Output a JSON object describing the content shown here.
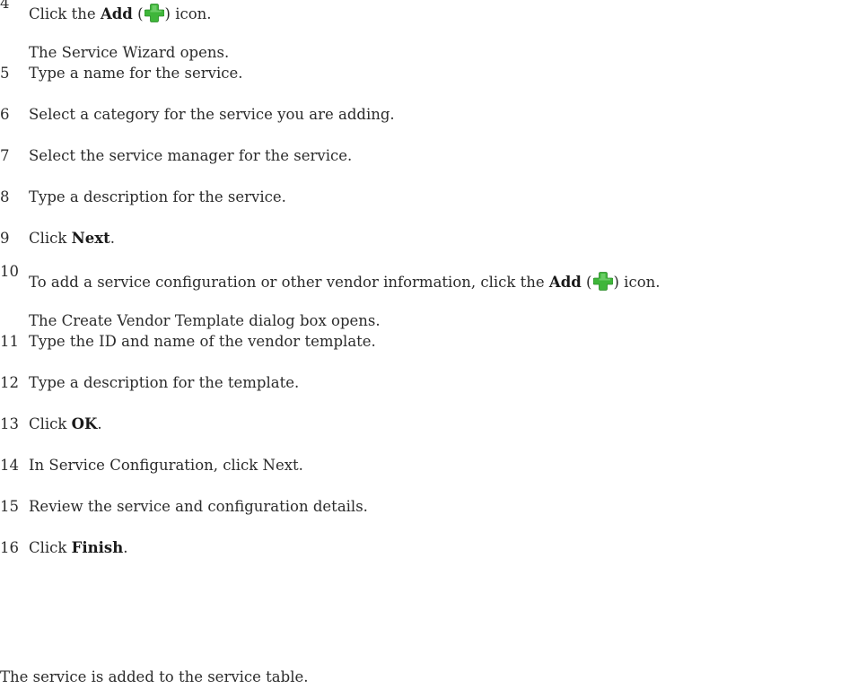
{
  "steps": [
    {
      "num": "4",
      "parts": [
        {
          "t": "Click the "
        },
        {
          "b": "Add"
        },
        {
          "t": " ("
        },
        {
          "icon": "plus-icon"
        },
        {
          "t": ") icon."
        }
      ],
      "note": "The Service Wizard opens."
    },
    {
      "num": "5",
      "parts": [
        {
          "t": "Type a name for the service."
        }
      ]
    },
    {
      "num": "6",
      "parts": [
        {
          "t": "Select a category for the service you are adding."
        }
      ]
    },
    {
      "num": "7",
      "parts": [
        {
          "t": "Select the service manager for the service."
        }
      ]
    },
    {
      "num": "8",
      "parts": [
        {
          "t": "Type a description for the service."
        }
      ]
    },
    {
      "num": "9",
      "parts": [
        {
          "t": "Click "
        },
        {
          "b": "Next"
        },
        {
          "t": "."
        }
      ]
    },
    {
      "num": "10",
      "parts": [
        {
          "t": "To add a service configuration or other vendor information, click the "
        },
        {
          "b": "Add"
        },
        {
          "t": " ("
        },
        {
          "icon": "plus-icon"
        },
        {
          "t": ") icon."
        }
      ],
      "note": "The Create Vendor Template dialog box opens."
    },
    {
      "num": "11",
      "parts": [
        {
          "t": "Type the ID and name of the vendor template."
        }
      ]
    },
    {
      "num": "12",
      "parts": [
        {
          "t": "Type a description for the template."
        }
      ]
    },
    {
      "num": "13",
      "parts": [
        {
          "t": "Click "
        },
        {
          "b": "OK"
        },
        {
          "t": "."
        }
      ]
    },
    {
      "num": "14",
      "parts": [
        {
          "t": "In Service Configuration, click Next."
        }
      ]
    },
    {
      "num": "15",
      "parts": [
        {
          "t": "Review the service and configuration details."
        }
      ]
    },
    {
      "num": "16",
      "parts": [
        {
          "t": "Click "
        },
        {
          "b": "Finish"
        },
        {
          "t": "."
        }
      ]
    }
  ],
  "closing": "The service is added to the service table.",
  "colors": {
    "text": "#2b2b2b",
    "icon_green": "#3fb63a"
  }
}
